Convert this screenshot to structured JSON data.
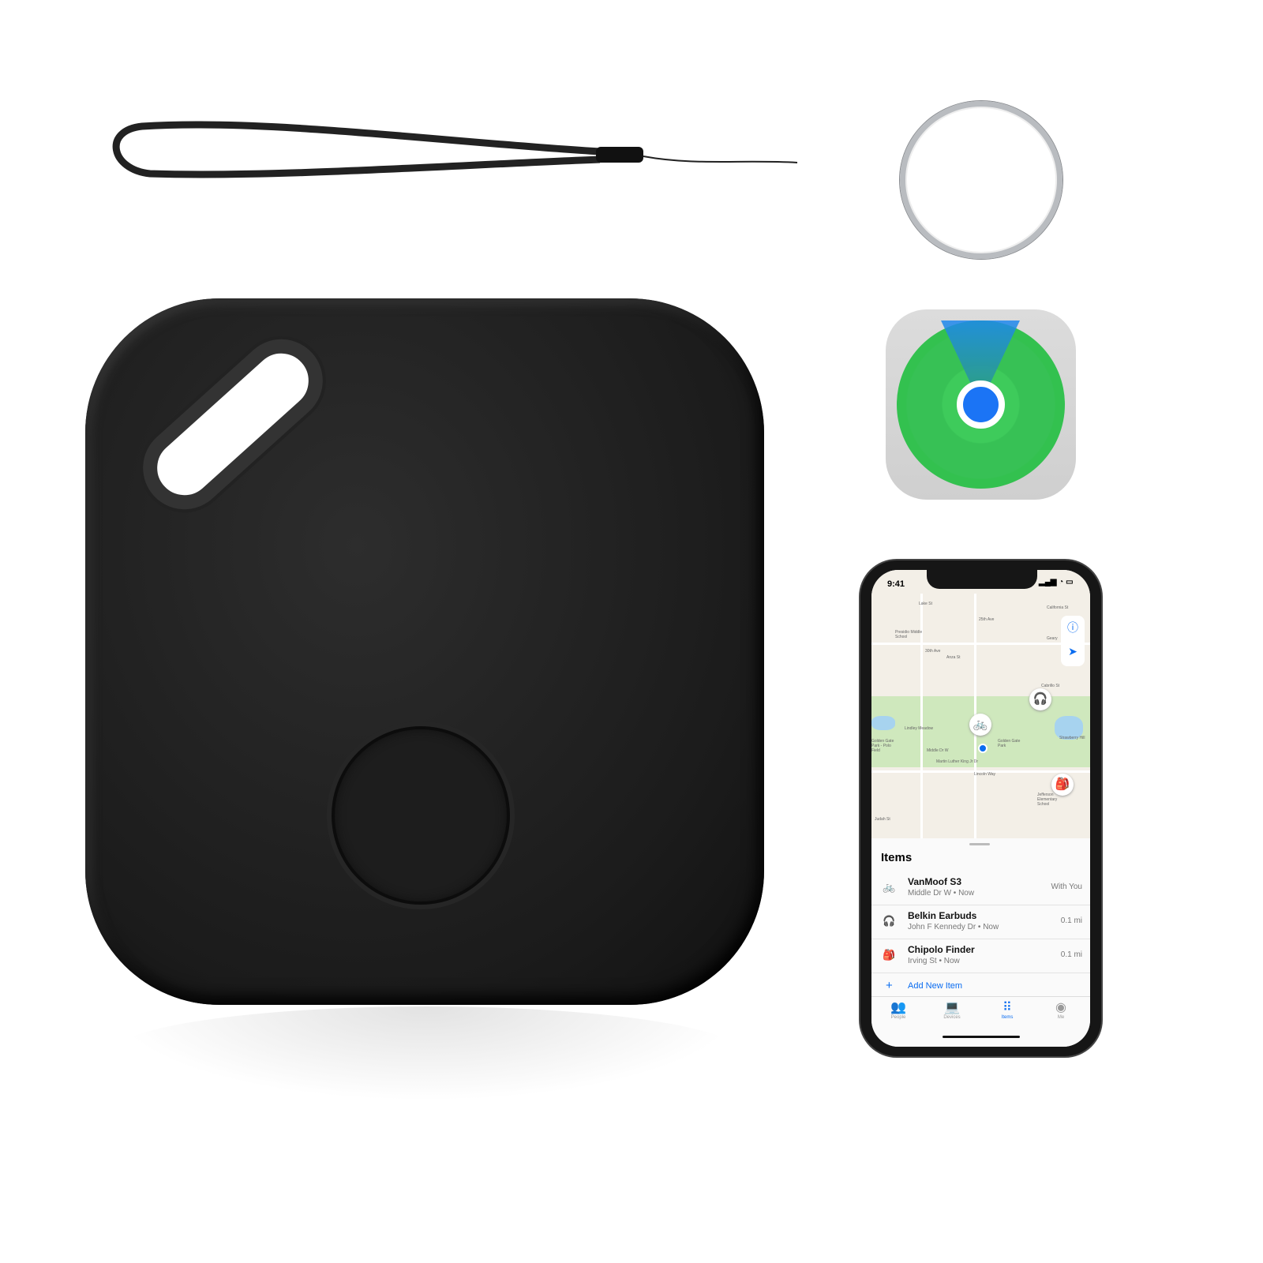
{
  "phone": {
    "status_time": "9:41",
    "map_labels": [
      "Lake St",
      "California St",
      "Geary",
      "Presidio Middle School",
      "Anza St",
      "Cabrillo St",
      "Lindley Meadow",
      "Golden Gate Park",
      "Golden Gate Park - Polo Field",
      "Middle Dr W",
      "Martin Luther King Jr Dr",
      "Lincoln Way",
      "Strawberry Hill",
      "Jefferson Elementary School",
      "Judah St",
      "25th Ave",
      "30th Ave"
    ],
    "sheet_title": "Items",
    "items": [
      {
        "icon": "bicycle-icon",
        "name": "VanMoof S3",
        "subtitle": "Middle Dr W • Now",
        "distance": "With You"
      },
      {
        "icon": "headphones-icon",
        "name": "Belkin Earbuds",
        "subtitle": "John F Kennedy Dr • Now",
        "distance": "0.1 mi"
      },
      {
        "icon": "backpack-icon",
        "name": "Chipolo Finder",
        "subtitle": "Irving St • Now",
        "distance": "0.1 mi"
      }
    ],
    "add_item": "Add New Item",
    "tabs": [
      {
        "label": "People",
        "icon": "people-icon",
        "active": false
      },
      {
        "label": "Devices",
        "icon": "devices-icon",
        "active": false
      },
      {
        "label": "Items",
        "icon": "items-icon",
        "active": true
      },
      {
        "label": "Me",
        "icon": "person-icon",
        "active": false
      }
    ],
    "accent": "#0a6cf0"
  },
  "colors": {
    "tracker": "#1f1f1f",
    "findmy_green": "#37c155",
    "findmy_blue": "#1b74f5"
  }
}
